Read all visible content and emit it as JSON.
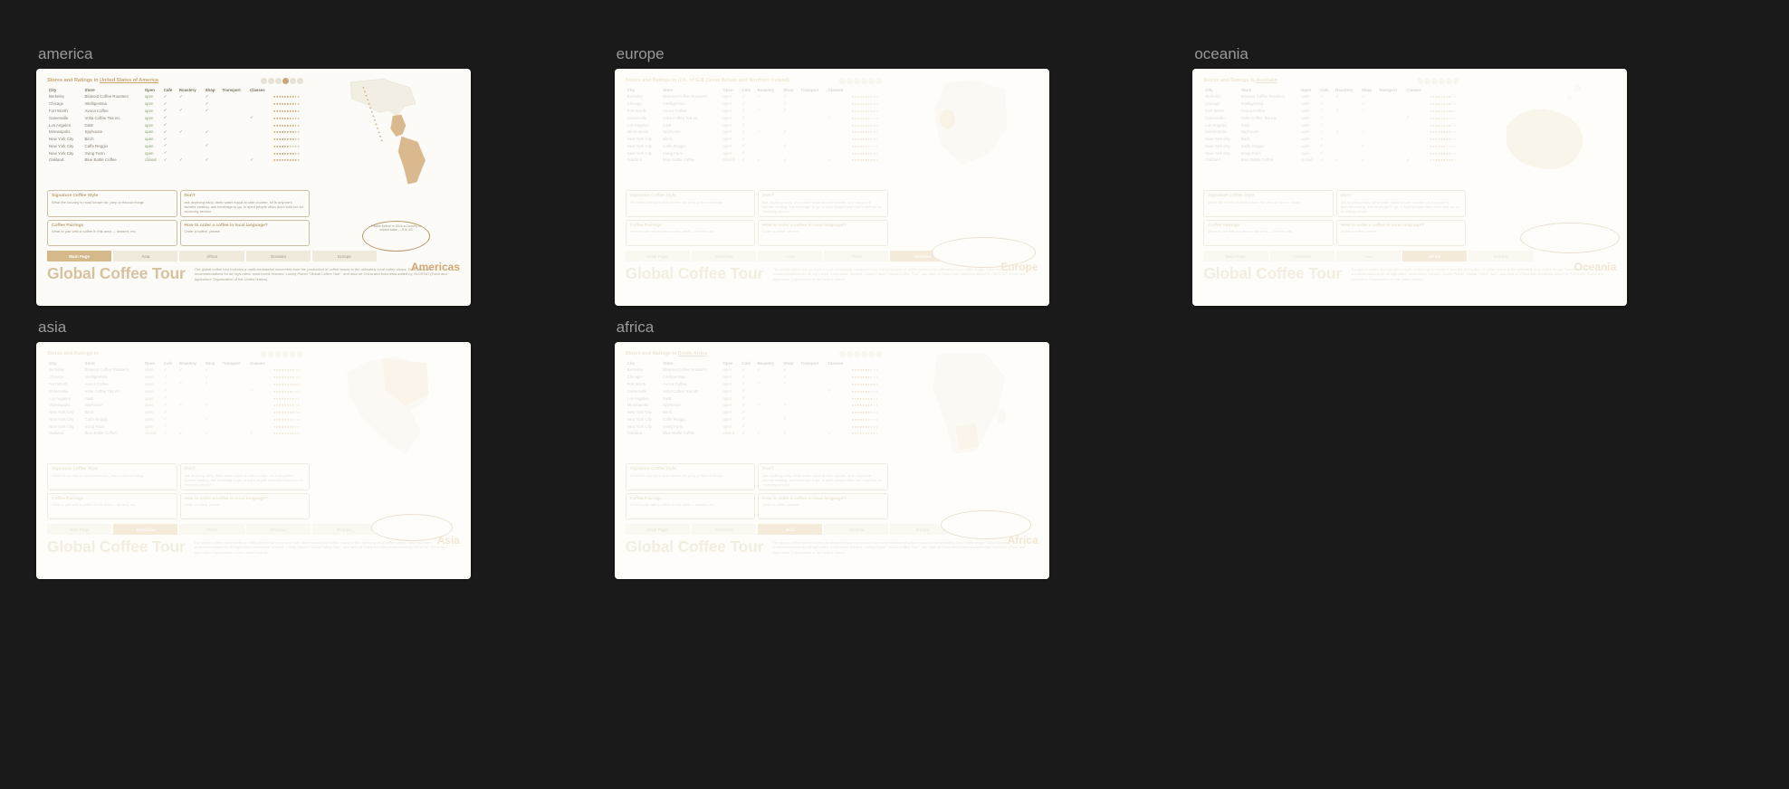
{
  "thumbs": {
    "america": {
      "label": "america",
      "region": "Americas",
      "title_country": "United States of America",
      "nav_active": 0,
      "nav": [
        "Main Page",
        "Asia",
        "Africa",
        "Oceania",
        "Europe"
      ],
      "callout": "Please Select or Click a Country or\nsubmit state — if in US"
    },
    "europe": {
      "label": "europe",
      "region": "Europe",
      "title_html": "Stores and Ratings in U.K. of G.B (Great Britain and Northern Ireland)",
      "nav_active": 4,
      "nav": [
        "Main Page",
        "Americas",
        "Asia",
        "Africa",
        "Oceania"
      ]
    },
    "oceania": {
      "label": "oceania",
      "region": "Oceania",
      "title_country": "Australia",
      "nav_active": 3,
      "nav": [
        "Main Page",
        "Americas",
        "Asia",
        "Africa",
        "Europe"
      ]
    },
    "asia": {
      "label": "asia",
      "region": "Asia",
      "title_country": " ",
      "nav_active": 1,
      "nav": [
        "Main Page",
        "Americas",
        "Africa",
        "Oceania",
        "Europe"
      ]
    },
    "africa": {
      "label": "africa",
      "region": "Africa",
      "title_country": "South Africa",
      "nav_active": 2,
      "nav": [
        "Main Page",
        "Americas",
        "Asia",
        "Oceania",
        "Europe"
      ]
    }
  },
  "table": {
    "cols": [
      "City",
      "Store",
      "Open",
      "Cafe",
      "Roastery",
      "Shop",
      "Transport",
      "Classes"
    ],
    "rows": [
      [
        "Berkeley",
        "Blowout Coffee Roasters",
        "open",
        "✓",
        "✓",
        "✓",
        "",
        "",
        "8"
      ],
      [
        "Chicago",
        "Intelligentsia",
        "open",
        "✓",
        "",
        "✓",
        "",
        "",
        "8"
      ],
      [
        "Fort Worth",
        "Avoca Coffee",
        "open",
        "✓",
        "✓",
        "✓",
        "",
        "",
        "9"
      ],
      [
        "Gainesville",
        "Volta Coffee Tea etc",
        "open",
        "✓",
        "",
        "",
        "",
        "✓",
        "7"
      ],
      [
        "Los Angeles",
        "G&B",
        "open",
        "✓",
        "",
        "",
        "",
        "",
        "8"
      ],
      [
        "Minneapolis",
        "Spyhouse",
        "open",
        "✓",
        "✓",
        "✓",
        "",
        "",
        "8"
      ],
      [
        "New York City",
        "Birch",
        "open",
        "✓",
        "",
        "",
        "",
        "",
        "8"
      ],
      [
        "New York City",
        "Caffe Reggio",
        "open",
        "✓",
        "",
        "✓",
        "",
        "",
        "6"
      ],
      [
        "New York City",
        "Irving Farm",
        "open",
        "✓",
        "",
        "",
        "",
        "",
        "8"
      ],
      [
        "Oakland",
        "Blue Bottle Coffee",
        "closed",
        "✓",
        "✓",
        "✓",
        "",
        "✓",
        "9"
      ]
    ]
  },
  "tiles": [
    {
      "title": "Signature Coffee Style",
      "body": "What the country is most known for, prep or flavour things"
    },
    {
      "title": "Don't",
      "body": "ask anything early, drink water equal at cafe counter, sit in anyone's favorite seating, ask beverage to go, in spirit people often don't wait too for receiving service"
    },
    {
      "title": "Coffee Pairings",
      "body": "What to pair with a coffee in this area — dessert, etc"
    },
    {
      "title": "How to order a coffee in local language?",
      "body": "Order a coffee, please"
    }
  ],
  "footer": {
    "logo": "Global Coffee Tour",
    "blurb": "The global coffee tour includes a multi-continental movement from the production of coffee beans to the ultimately local coffee shops. Data has been recommendations for all high-rated, most loved, brewed. Lonely Planet \"Global Coffee Tour\", and data off China and Indonesia added by FAOSTAT (Food and Agriculture Organization of the United Nation)."
  },
  "title_prefix": "Stores and Ratings in "
}
